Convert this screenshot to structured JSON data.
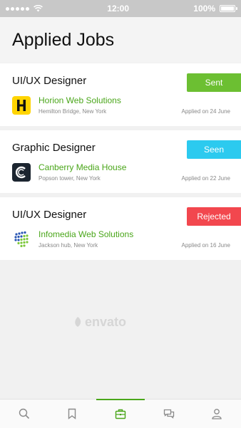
{
  "status_bar": {
    "time": "12:00",
    "battery": "100%"
  },
  "header": {
    "title": "Applied Jobs"
  },
  "jobs": [
    {
      "title": "UI/UX Designer",
      "status": "Sent",
      "status_color": "#6cbf32",
      "company": "Horion Web Solutions",
      "address": "Hemilton Bridge, New York",
      "applied": "Applied on 24 June",
      "logo": "letter-h-logo"
    },
    {
      "title": "Graphic Designer",
      "status": "Seen",
      "status_color": "#2ccaef",
      "company": "Canberry Media House",
      "address": "Popson tower, New York",
      "applied": "Applied on 22 June",
      "logo": "letter-c-logo"
    },
    {
      "title": "UI/UX Designer",
      "status": "Rejected",
      "status_color": "#f2474e",
      "company": "Infomedia Web Solutions",
      "address": "Jackson hub, New York",
      "applied": "Applied on 16 June",
      "logo": "dot-grid-logo"
    }
  ],
  "watermark": "envato",
  "nav": [
    "search-icon",
    "bookmark-icon",
    "briefcase-icon",
    "chat-icon",
    "profile-icon"
  ],
  "accent_color": "#4aa61a"
}
